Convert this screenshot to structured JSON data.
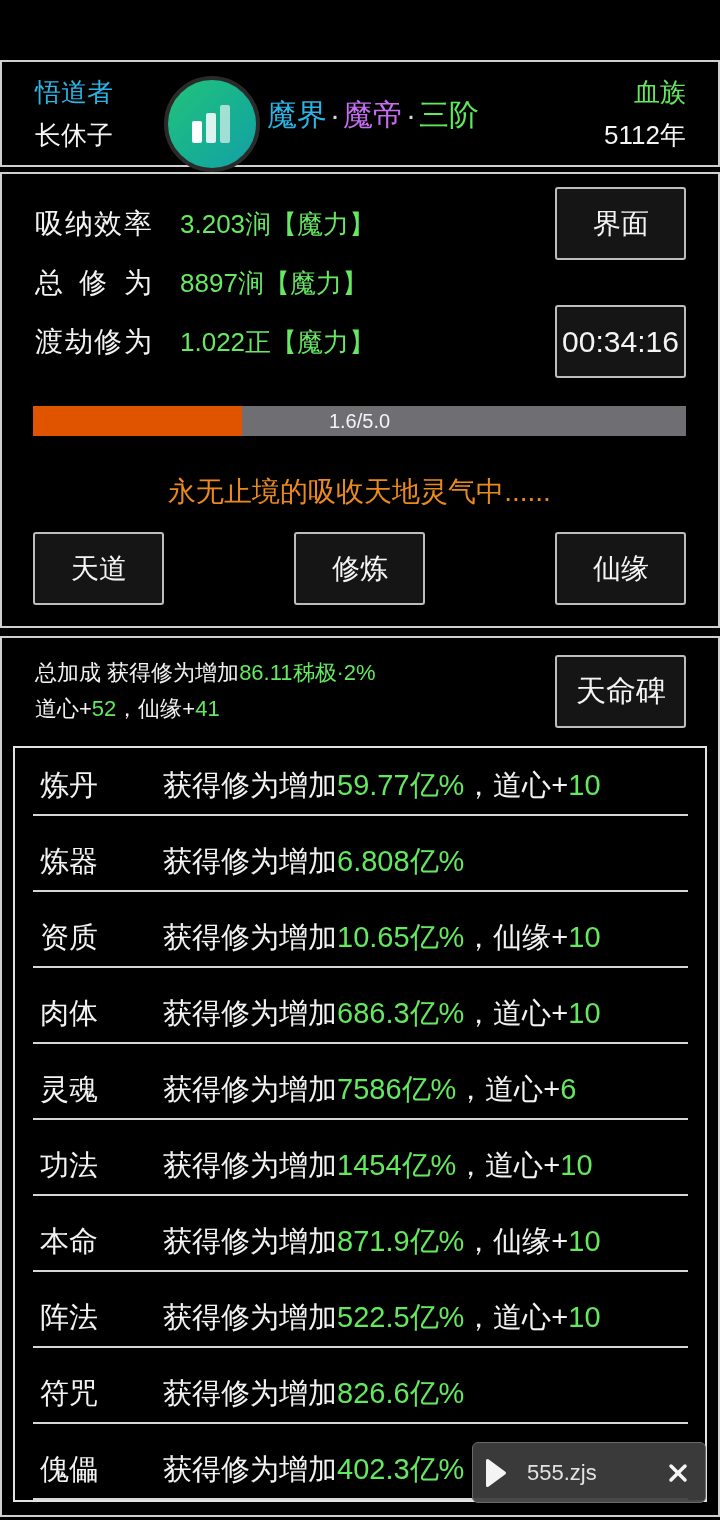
{
  "header": {
    "role": "悟道者",
    "name": "长休子",
    "title": [
      {
        "kind": "segment",
        "text": "魔界",
        "color": "#2ab5e6"
      },
      {
        "kind": "separator",
        "text": "·"
      },
      {
        "kind": "segment",
        "text": "魔帝",
        "color": "#c56ff0"
      },
      {
        "kind": "separator",
        "text": "·"
      },
      {
        "kind": "segment",
        "text": "三阶",
        "color": "#5eea5a"
      }
    ],
    "race": "血族",
    "age": "5112年"
  },
  "stats": [
    {
      "label": "吸纳效率",
      "value": "3.203涧【魔力】"
    },
    {
      "label": "总 修 为",
      "value": "8897涧【魔力】"
    },
    {
      "label": "渡劫修为",
      "value": "1.022正【魔力】"
    }
  ],
  "interface_button": "界面",
  "timer": "00:34:16",
  "progress": {
    "level": 0.32,
    "reading": "1.6/5.0"
  },
  "status": "永无止境的吸收天地灵气中......",
  "actions": [
    "天道",
    "修炼",
    "仙缘"
  ],
  "summary": {
    "lines": [
      [
        {
          "kind": "label",
          "text": "总加成 获得修为增加"
        },
        {
          "kind": "value",
          "text": "86.11秭极·2%"
        }
      ],
      [
        {
          "kind": "label",
          "text": "道心+"
        },
        {
          "kind": "value",
          "text": "52"
        },
        {
          "kind": "label",
          "text": "，仙缘+"
        },
        {
          "kind": "value",
          "text": "41"
        }
      ]
    ],
    "button": "天命碑"
  },
  "rows": [
    {
      "name": "炼丹",
      "segments": [
        {
          "kind": "label",
          "text": "获得修为增加"
        },
        {
          "kind": "value",
          "text": "59.77亿%"
        },
        {
          "kind": "label",
          "text": "，道心+"
        },
        {
          "kind": "value",
          "text": "10"
        }
      ]
    },
    {
      "name": "炼器",
      "segments": [
        {
          "kind": "label",
          "text": "获得修为增加"
        },
        {
          "kind": "value",
          "text": "6.808亿%"
        }
      ]
    },
    {
      "name": "资质",
      "segments": [
        {
          "kind": "label",
          "text": "获得修为增加"
        },
        {
          "kind": "value",
          "text": "10.65亿%"
        },
        {
          "kind": "label",
          "text": "，仙缘+"
        },
        {
          "kind": "value",
          "text": "10"
        }
      ]
    },
    {
      "name": "肉体",
      "segments": [
        {
          "kind": "label",
          "text": "获得修为增加"
        },
        {
          "kind": "value",
          "text": "686.3亿%"
        },
        {
          "kind": "label",
          "text": "，道心+"
        },
        {
          "kind": "value",
          "text": "10"
        }
      ]
    },
    {
      "name": "灵魂",
      "segments": [
        {
          "kind": "label",
          "text": "获得修为增加"
        },
        {
          "kind": "value",
          "text": "7586亿%"
        },
        {
          "kind": "label",
          "text": "，道心+"
        },
        {
          "kind": "value",
          "text": "6"
        }
      ]
    },
    {
      "name": "功法",
      "segments": [
        {
          "kind": "label",
          "text": "获得修为增加"
        },
        {
          "kind": "value",
          "text": "1454亿%"
        },
        {
          "kind": "label",
          "text": "，道心+"
        },
        {
          "kind": "value",
          "text": "10"
        }
      ]
    },
    {
      "name": "本命",
      "segments": [
        {
          "kind": "label",
          "text": "获得修为增加"
        },
        {
          "kind": "value",
          "text": "871.9亿%"
        },
        {
          "kind": "label",
          "text": "，仙缘+"
        },
        {
          "kind": "value",
          "text": "10"
        }
      ]
    },
    {
      "name": "阵法",
      "segments": [
        {
          "kind": "label",
          "text": "获得修为增加"
        },
        {
          "kind": "value",
          "text": "522.5亿%"
        },
        {
          "kind": "label",
          "text": "，道心+"
        },
        {
          "kind": "value",
          "text": "10"
        }
      ]
    },
    {
      "name": "符咒",
      "segments": [
        {
          "kind": "label",
          "text": "获得修为增加"
        },
        {
          "kind": "value",
          "text": "826.6亿%"
        }
      ]
    },
    {
      "name": "傀儡",
      "segments": [
        {
          "kind": "label",
          "text": "获得修为增加"
        },
        {
          "kind": "value",
          "text": "402.3亿%"
        }
      ]
    }
  ],
  "player": {
    "script_name": "555.zjs"
  }
}
